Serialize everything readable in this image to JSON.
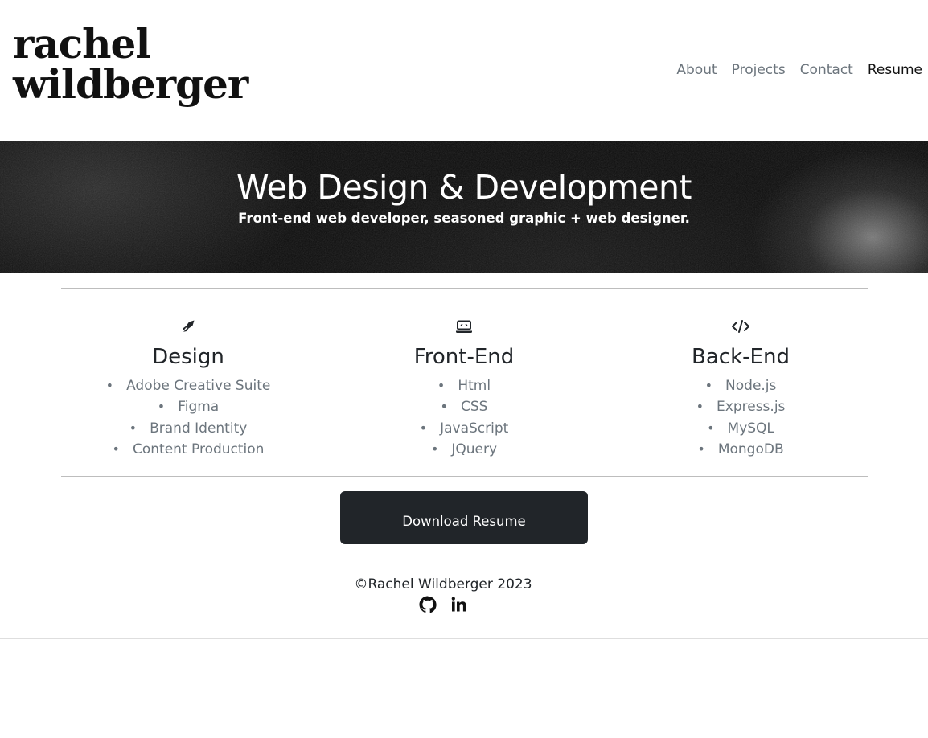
{
  "header": {
    "logo_line1": "rachel",
    "logo_line2": "wildberger",
    "nav": [
      {
        "label": "About"
      },
      {
        "label": "Projects"
      },
      {
        "label": "Contact"
      },
      {
        "label": "Resume",
        "active": true
      }
    ]
  },
  "hero": {
    "title": "Web Design & Development",
    "subtitle": "Front-end web developer, seasoned graphic + web designer."
  },
  "skills": [
    {
      "icon": "pen-nib-icon",
      "title": "Design",
      "items": [
        "Adobe Creative Suite",
        "Figma",
        "Brand Identity",
        "Content Production"
      ]
    },
    {
      "icon": "laptop-code-icon",
      "title": "Front-End",
      "items": [
        "Html",
        "CSS",
        "JavaScript",
        "JQuery"
      ]
    },
    {
      "icon": "code-icon",
      "title": "Back-End",
      "items": [
        "Node.js",
        "Express.js",
        "MySQL",
        "MongoDB"
      ]
    }
  ],
  "download_button": "Download Resume",
  "footer": {
    "copyright": "©Rachel Wildberger 2023",
    "social": [
      {
        "icon": "github-icon"
      },
      {
        "icon": "linkedin-icon"
      }
    ]
  },
  "colors": {
    "text_dark": "#212529",
    "text_muted": "#6c757d",
    "button_bg": "#212529",
    "hero_bg": "#0b0b0b"
  }
}
